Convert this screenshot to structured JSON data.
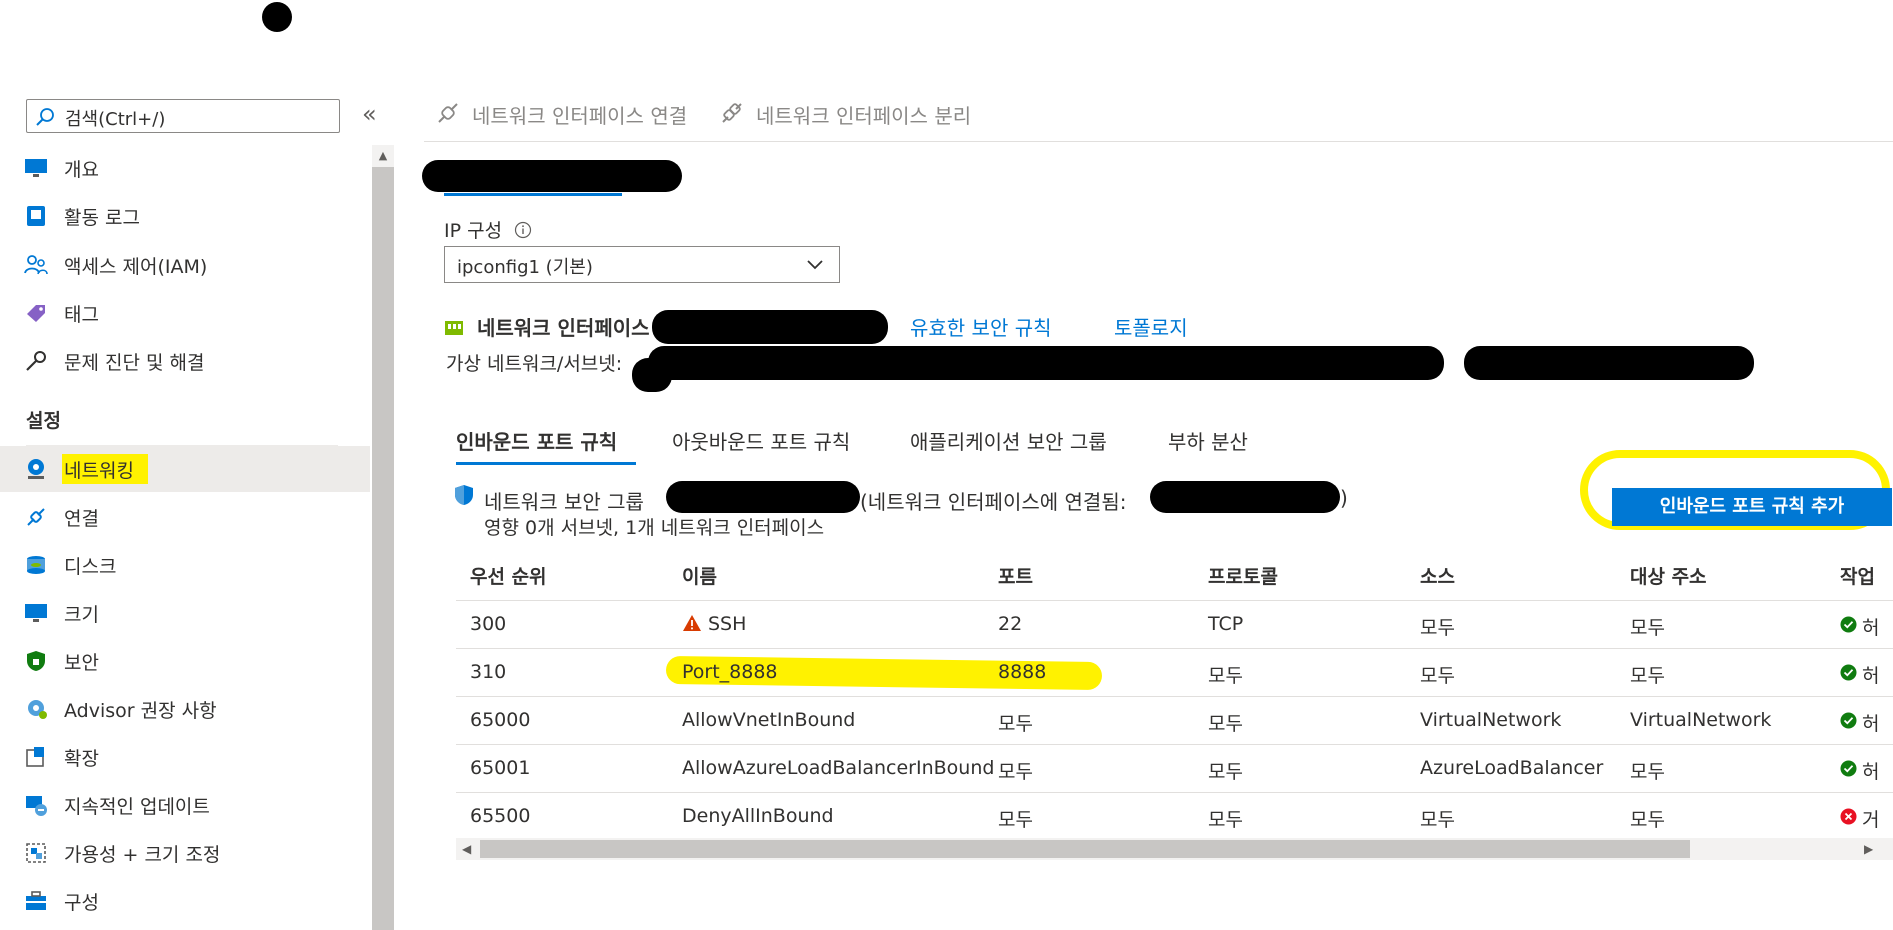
{
  "sidebar": {
    "search_placeholder": "검색(Ctrl+/)",
    "collapse_glyph": "«",
    "items": [
      {
        "label": "개요",
        "icon": "monitor-icon"
      },
      {
        "label": "활동 로그",
        "icon": "activity-log-icon"
      },
      {
        "label": "액세스 제어(IAM)",
        "icon": "people-icon"
      },
      {
        "label": "태그",
        "icon": "tag-icon"
      },
      {
        "label": "문제 진단 및 해결",
        "icon": "wrench-icon"
      }
    ],
    "section_title": "설정",
    "settings_items": [
      {
        "label": "네트워킹",
        "icon": "networking-icon",
        "active": true
      },
      {
        "label": "연결",
        "icon": "connect-icon"
      },
      {
        "label": "디스크",
        "icon": "disk-icon"
      },
      {
        "label": "크기",
        "icon": "size-monitor-icon"
      },
      {
        "label": "보안",
        "icon": "shield-icon"
      },
      {
        "label": "Advisor 권장 사항",
        "icon": "advisor-icon"
      },
      {
        "label": "확장",
        "icon": "extensions-icon"
      },
      {
        "label": "지속적인 업데이트",
        "icon": "updates-icon"
      },
      {
        "label": "가용성 + 크기 조정",
        "icon": "availability-icon"
      },
      {
        "label": "구성",
        "icon": "configuration-icon"
      }
    ]
  },
  "toolbar": {
    "attach_label": "네트워크 인터페이스 연결",
    "detach_label": "네트워크 인터페이스 분리"
  },
  "ip_config": {
    "label": "IP 구성",
    "selected": "ipconfig1 (기본)"
  },
  "nic": {
    "title": "네트워크 인터페이스",
    "effective_rules_link": "유효한 보안 규칙",
    "topology_link": "토폴로지",
    "vnet_label": "가상 네트워크/서브넷:"
  },
  "tabs": [
    {
      "label": "인바운드 포트 규칙",
      "active": true
    },
    {
      "label": "아웃바운드 포트 규칙"
    },
    {
      "label": "애플리케이션 보안 그룹"
    },
    {
      "label": "부하 분산"
    }
  ],
  "nsg": {
    "prefix": "네트워크 보안 그룹",
    "attached": "(네트워크 인터페이스에 연결됨:",
    "closing": ")",
    "impact": "영향 0개 서브넷, 1개 네트워크 인터페이스"
  },
  "add_button": "인바운드 포트 규칙 추가",
  "table": {
    "headers": [
      "우선 순위",
      "이름",
      "포트",
      "프로토콜",
      "소스",
      "대상 주소",
      "작업"
    ],
    "rows": [
      {
        "priority": "300",
        "name": "SSH",
        "warning": true,
        "port": "22",
        "protocol": "TCP",
        "source": "모두",
        "dest": "모두",
        "action": "허",
        "status": "allow"
      },
      {
        "priority": "310",
        "name": "Port_8888",
        "port": "8888",
        "protocol": "모두",
        "source": "모두",
        "dest": "모두",
        "action": "허",
        "status": "allow"
      },
      {
        "priority": "65000",
        "name": "AllowVnetInBound",
        "port": "모두",
        "protocol": "모두",
        "source": "VirtualNetwork",
        "dest": "VirtualNetwork",
        "action": "허",
        "status": "allow"
      },
      {
        "priority": "65001",
        "name": "AllowAzureLoadBalancerInBound",
        "port": "모두",
        "protocol": "모두",
        "source": "AzureLoadBalancer",
        "dest": "모두",
        "action": "허",
        "status": "allow"
      },
      {
        "priority": "65500",
        "name": "DenyAllInBound",
        "port": "모두",
        "protocol": "모두",
        "source": "모두",
        "dest": "모두",
        "action": "거",
        "status": "deny"
      }
    ]
  },
  "colors": {
    "accent": "#0078d4",
    "allow": "#107c10",
    "deny": "#e81123",
    "warning": "#d83b01",
    "highlight": "#fff200"
  }
}
